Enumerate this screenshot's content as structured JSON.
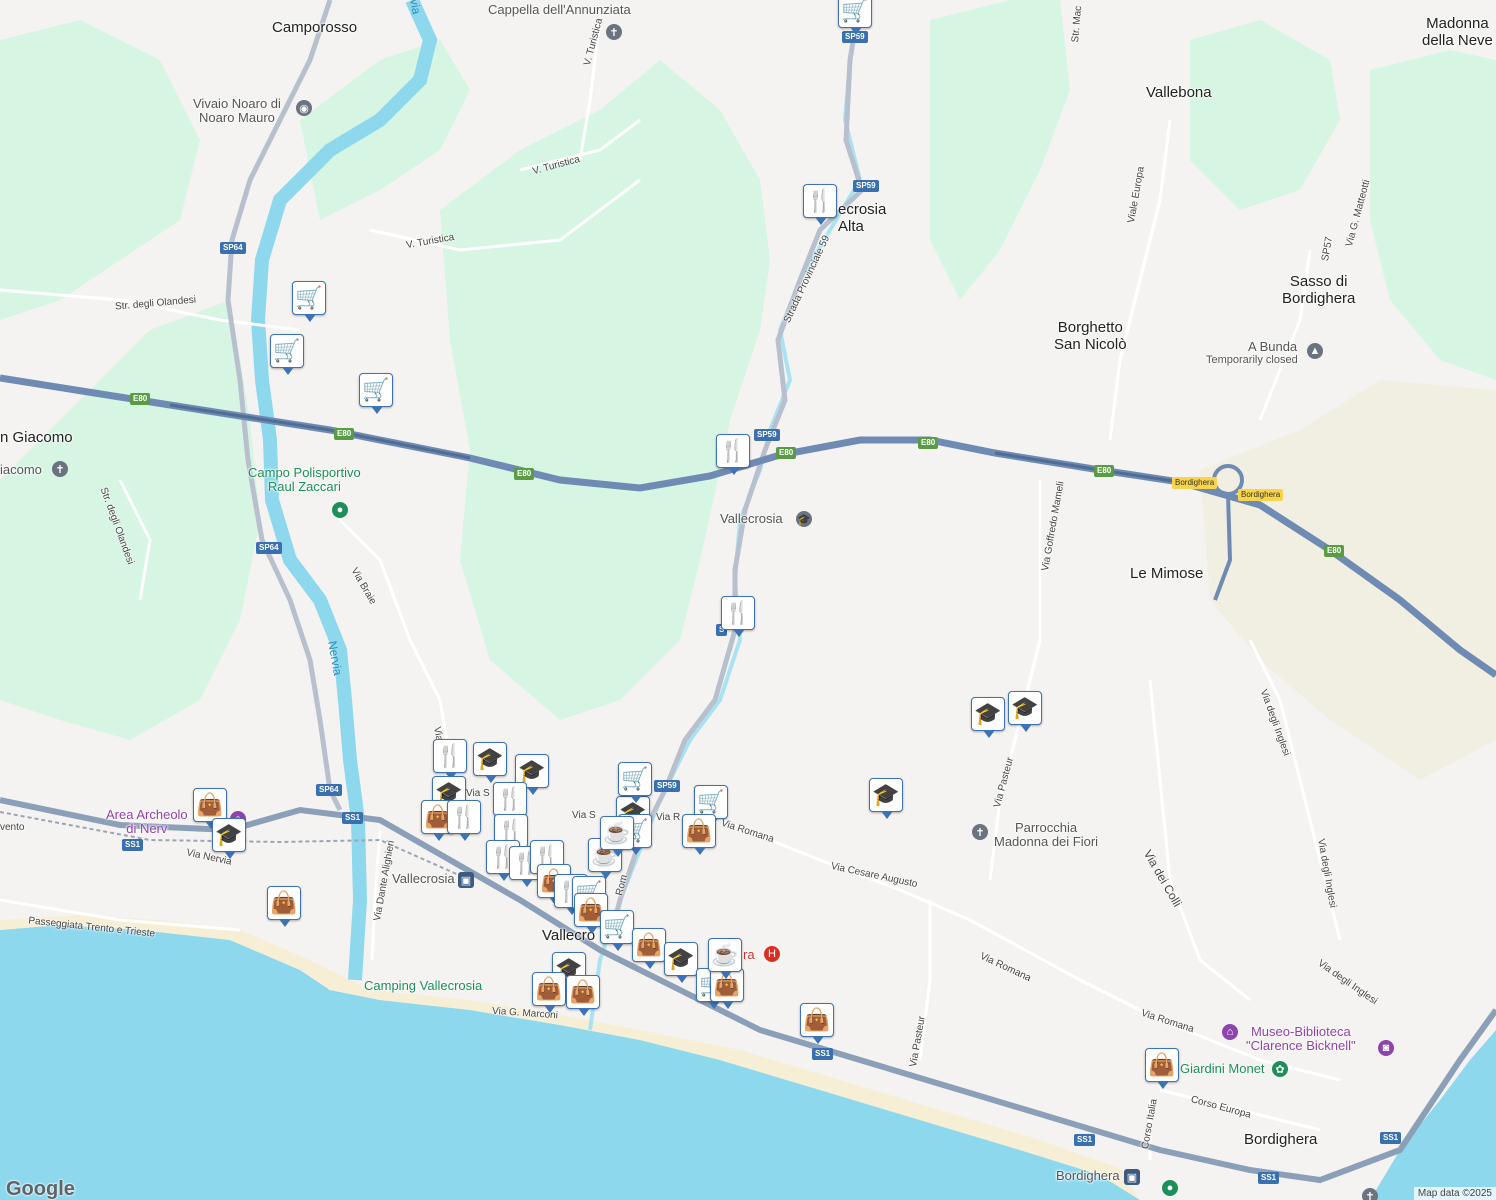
{
  "map": {
    "attribution": "Map data ©2025",
    "logo": "Google",
    "colors": {
      "land": "#f4f3f1",
      "park": "#d6f5e3",
      "sea": "#8ed8ee",
      "river": "#8ed8ee",
      "motorway": "#6f8bb3",
      "beach": "#f6efd6"
    }
  },
  "places": [
    {
      "id": "camporosso",
      "text": "Camporosso",
      "type": "town"
    },
    {
      "id": "vallebona",
      "text": "Vallebona",
      "type": "town"
    },
    {
      "id": "madonna-neve",
      "text": "Madonna\ndella Neve",
      "type": "town"
    },
    {
      "id": "vallecrosia-alta",
      "text": "ecrosia\nAlta",
      "type": "town"
    },
    {
      "id": "sasso",
      "text": "Sasso di\nBordighera",
      "type": "town"
    },
    {
      "id": "borghetto",
      "text": "Borghetto\nSan Nicolò",
      "type": "town"
    },
    {
      "id": "san-giacomo",
      "text": "n Giacomo",
      "type": "town"
    },
    {
      "id": "le-mimose",
      "text": "Le Mimose",
      "type": "town"
    },
    {
      "id": "vallecrosia-town",
      "text": "Vallecro",
      "type": "town"
    },
    {
      "id": "bordighera",
      "text": "Bordighera",
      "type": "town"
    }
  ],
  "pois": [
    {
      "id": "cappella",
      "text": "Cappella dell'Annunziata",
      "icon": "cross-icon"
    },
    {
      "id": "vivaio",
      "text": "Vivaio Noaro di\nNoaro Mauro",
      "icon": "shop-icon"
    },
    {
      "id": "giacomo-church",
      "text": "iacomo",
      "icon": "cross-icon"
    },
    {
      "id": "campo",
      "text": "Campo Polisportivo\nRaul Zaccari",
      "icon": "sport-icon"
    },
    {
      "id": "vallecrosia-school",
      "text": "Vallecrosia",
      "icon": "school-icon"
    },
    {
      "id": "a-bunda",
      "text": "A Bunda",
      "icon": "mountain-icon"
    },
    {
      "id": "a-bunda-status",
      "text": "Temporarily closed",
      "icon": ""
    },
    {
      "id": "area-arch",
      "text": "Area Archeolo\ndi Nerv",
      "icon": "museum-icon"
    },
    {
      "id": "vallecrosia-station",
      "text": "Vallecrosia",
      "icon": "train-icon"
    },
    {
      "id": "parrocchia",
      "text": "Parrocchia\nMadonna dei Fiori",
      "icon": "cross-icon"
    },
    {
      "id": "camping",
      "text": "Camping Vallecrosia",
      "icon": ""
    },
    {
      "id": "museo",
      "text": "Museo-Biblioteca\n\"Clarence Bicknell\"",
      "icon": "museum-icon"
    },
    {
      "id": "giardini",
      "text": "Giardini Monet",
      "icon": "flower-icon"
    },
    {
      "id": "bordighera-station",
      "text": "Bordighera",
      "icon": "train-icon"
    },
    {
      "id": "hospital-label",
      "text": "ra",
      "icon": "hospital-icon"
    }
  ],
  "roads": [
    {
      "id": "r1",
      "text": "V. Turistica"
    },
    {
      "id": "r2",
      "text": "V. Turistica"
    },
    {
      "id": "r3",
      "text": "V. Turistica"
    },
    {
      "id": "r4",
      "text": "Str. degli Olandesi"
    },
    {
      "id": "r5",
      "text": "Str. degli Olandesi"
    },
    {
      "id": "r6",
      "text": "Strada Provinciale 59"
    },
    {
      "id": "r7",
      "text": "Via Braie"
    },
    {
      "id": "r8",
      "text": "Via Goffredo Mameli"
    },
    {
      "id": "r9",
      "text": "Viale Europa"
    },
    {
      "id": "r10",
      "text": "Via G. Matteotti"
    },
    {
      "id": "r11",
      "text": "Via degli Inglesi"
    },
    {
      "id": "r12",
      "text": "Via degli Inglesi"
    },
    {
      "id": "r13",
      "text": "Via degli Inglesi"
    },
    {
      "id": "r14",
      "text": "Via dei Colli"
    },
    {
      "id": "r15",
      "text": "Via Pasteur"
    },
    {
      "id": "r16",
      "text": "Via Pasteur"
    },
    {
      "id": "r17",
      "text": "Via Romana"
    },
    {
      "id": "r18",
      "text": "Via Romana"
    },
    {
      "id": "r19",
      "text": "Via Romana"
    },
    {
      "id": "r20",
      "text": "Via Cesare Augusto"
    },
    {
      "id": "r21",
      "text": "Via Nervia"
    },
    {
      "id": "r22",
      "text": "Via Dante Alighieri"
    },
    {
      "id": "r23",
      "text": "Passeggiata Trento e Trieste"
    },
    {
      "id": "r24",
      "text": "Via G. Marconi"
    },
    {
      "id": "r25",
      "text": "Corso Europa"
    },
    {
      "id": "r26",
      "text": "Corso Italia"
    },
    {
      "id": "r27",
      "text": "Str. Mac"
    },
    {
      "id": "r28",
      "text": "vento"
    },
    {
      "id": "r29",
      "text": "Via R"
    },
    {
      "id": "r30",
      "text": "Via S"
    },
    {
      "id": "r31",
      "text": "Via S"
    },
    {
      "id": "r32",
      "text": "Via"
    },
    {
      "id": "r33",
      "text": "Rom"
    },
    {
      "id": "r34",
      "text": "SP57"
    }
  ],
  "water_labels": [
    {
      "id": "nervia",
      "text": "Nervia"
    },
    {
      "id": "nervia-top",
      "text": "via"
    }
  ],
  "shields": [
    {
      "id": "s1",
      "text": "SP59",
      "kind": "ss"
    },
    {
      "id": "s2",
      "text": "SP59",
      "kind": "ss"
    },
    {
      "id": "s3",
      "text": "SP59",
      "kind": "ss"
    },
    {
      "id": "s4",
      "text": "SP59",
      "kind": "ss"
    },
    {
      "id": "s5",
      "text": "SP64",
      "kind": "ss"
    },
    {
      "id": "s6",
      "text": "SP64",
      "kind": "ss"
    },
    {
      "id": "s7",
      "text": "SP64",
      "kind": "ss"
    },
    {
      "id": "s8",
      "text": "E80",
      "kind": "e"
    },
    {
      "id": "s9",
      "text": "E80",
      "kind": "e"
    },
    {
      "id": "s10",
      "text": "E80",
      "kind": "e"
    },
    {
      "id": "s11",
      "text": "E80",
      "kind": "e"
    },
    {
      "id": "s12",
      "text": "E80",
      "kind": "e"
    },
    {
      "id": "s13",
      "text": "E80",
      "kind": "e"
    },
    {
      "id": "s14",
      "text": "E80",
      "kind": "e"
    },
    {
      "id": "s15",
      "text": "SS1",
      "kind": "ss"
    },
    {
      "id": "s16",
      "text": "SS1",
      "kind": "ss"
    },
    {
      "id": "s17",
      "text": "SS1",
      "kind": "ss"
    },
    {
      "id": "s18",
      "text": "SS1",
      "kind": "ss"
    },
    {
      "id": "s19",
      "text": "SS1",
      "kind": "ss"
    },
    {
      "id": "s20",
      "text": "SS1",
      "kind": "ss"
    },
    {
      "id": "s21",
      "text": "Bordighera",
      "kind": "yellow"
    },
    {
      "id": "s22",
      "text": "Bordighera",
      "kind": "yellow"
    },
    {
      "id": "s23",
      "text": "S",
      "kind": "ss"
    }
  ],
  "markers": [
    {
      "icon": "cart-icon",
      "glyph": "🛒"
    },
    {
      "icon": "restaurant-icon",
      "glyph": "🍴"
    },
    {
      "icon": "cart-icon",
      "glyph": "🛒"
    },
    {
      "icon": "cart-icon",
      "glyph": "🛒"
    },
    {
      "icon": "cart-icon",
      "glyph": "🛒"
    },
    {
      "icon": "restaurant-icon",
      "glyph": "🍴"
    },
    {
      "icon": "restaurant-icon",
      "glyph": "🍴"
    },
    {
      "icon": "school-icon",
      "glyph": "🎓"
    },
    {
      "icon": "school-icon",
      "glyph": "🎓"
    },
    {
      "icon": "school-icon",
      "glyph": "🎓"
    },
    {
      "icon": "bag-icon",
      "glyph": "👜"
    },
    {
      "icon": "school-icon",
      "glyph": "🎓"
    },
    {
      "icon": "bag-icon",
      "glyph": "👜"
    },
    {
      "icon": "restaurant-icon",
      "glyph": "🍴"
    },
    {
      "icon": "school-icon",
      "glyph": "🎓"
    },
    {
      "icon": "school-icon",
      "glyph": "🎓"
    },
    {
      "icon": "restaurant-icon",
      "glyph": "🍴"
    },
    {
      "icon": "school-icon",
      "glyph": "🎓"
    },
    {
      "icon": "bag-icon",
      "glyph": "👜"
    },
    {
      "icon": "restaurant-icon",
      "glyph": "🍴"
    },
    {
      "icon": "restaurant-icon",
      "glyph": "🍴"
    },
    {
      "icon": "school-icon",
      "glyph": "🎓"
    },
    {
      "icon": "cart-icon",
      "glyph": "🛒"
    },
    {
      "icon": "cart-icon",
      "glyph": "🛒"
    },
    {
      "icon": "bag-icon",
      "glyph": "👜"
    },
    {
      "icon": "coffee-icon",
      "glyph": "☕"
    },
    {
      "icon": "restaurant-icon",
      "glyph": "🍴"
    },
    {
      "icon": "restaurant-icon",
      "glyph": "🍴"
    },
    {
      "icon": "restaurant-icon",
      "glyph": "🍴"
    },
    {
      "icon": "bag-icon",
      "glyph": "👜"
    },
    {
      "icon": "restaurant-icon",
      "glyph": "🍴"
    },
    {
      "icon": "cart-icon",
      "glyph": "🛒"
    },
    {
      "icon": "bag-icon",
      "glyph": "👜"
    },
    {
      "icon": "cart-icon",
      "glyph": "🛒"
    },
    {
      "icon": "bag-icon",
      "glyph": "👜"
    },
    {
      "icon": "cart-icon",
      "glyph": "🛒"
    },
    {
      "icon": "school-icon",
      "glyph": "🎓"
    },
    {
      "icon": "school-icon",
      "glyph": "🎓"
    },
    {
      "icon": "bag-icon",
      "glyph": "👜"
    },
    {
      "icon": "cart-icon",
      "glyph": "🛒"
    },
    {
      "icon": "bag-icon",
      "glyph": "👜"
    },
    {
      "icon": "bag-icon",
      "glyph": "👜"
    },
    {
      "icon": "coffee-icon",
      "glyph": "☕"
    },
    {
      "icon": "bag-icon",
      "glyph": "👜"
    },
    {
      "icon": "bag-icon",
      "glyph": "👜"
    },
    {
      "icon": "coffee-icon",
      "glyph": "☕"
    }
  ]
}
